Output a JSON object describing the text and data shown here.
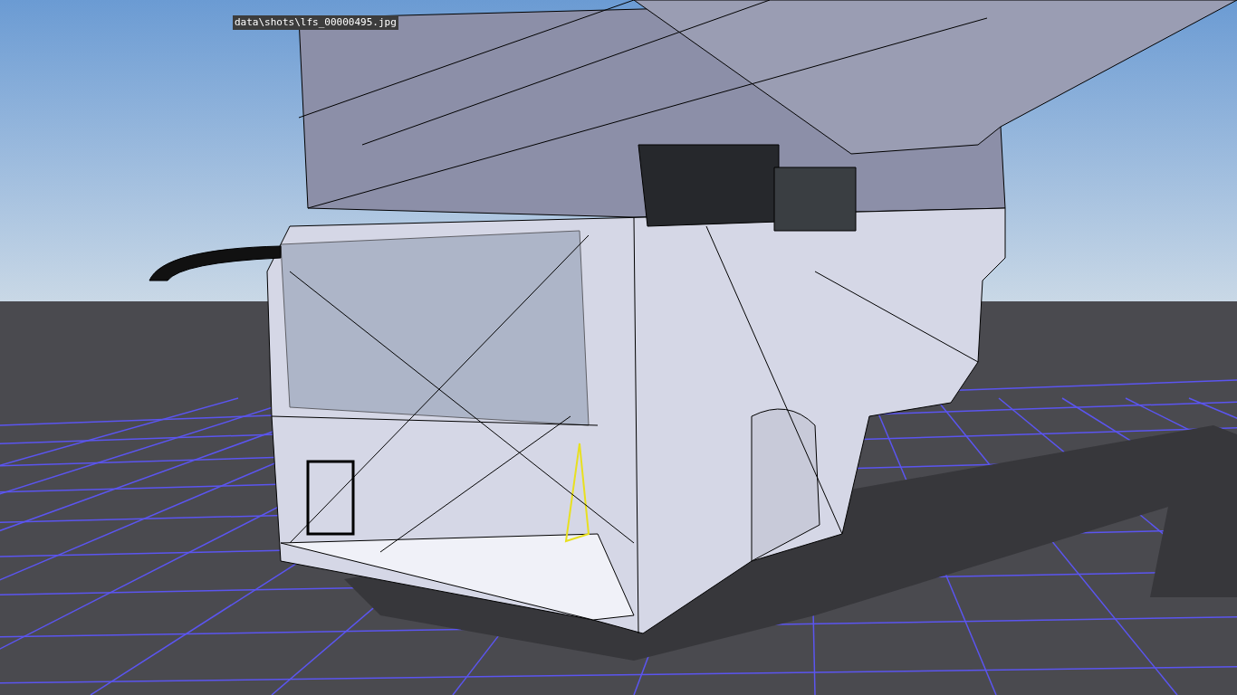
{
  "viewport": {
    "caption": "data\\shots\\lfs_00000495.jpg"
  }
}
